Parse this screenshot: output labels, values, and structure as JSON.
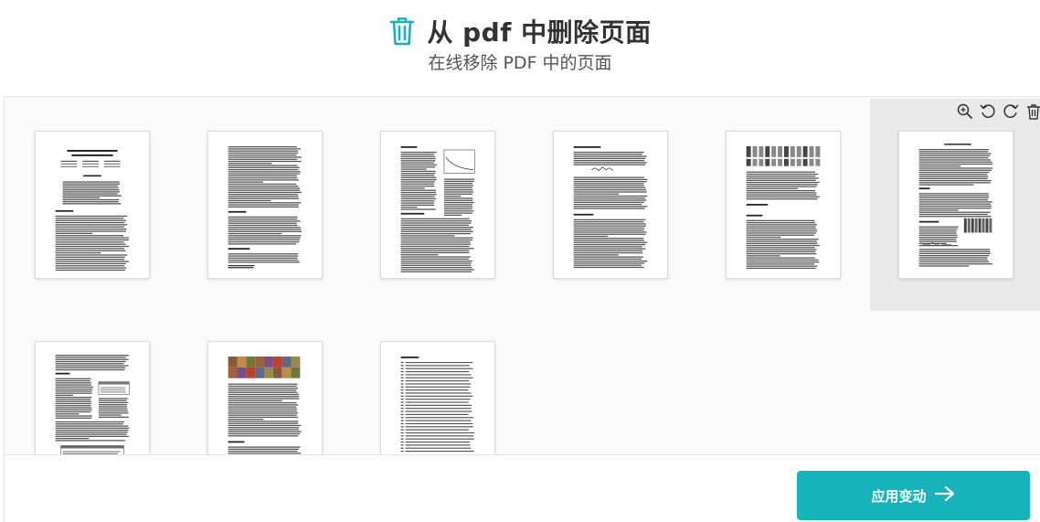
{
  "header": {
    "title": "从 pdf 中删除页面",
    "subtitle": "在线移除 PDF 中的页面",
    "icon": "trash-icon"
  },
  "colors": {
    "accent": "#17b3ba",
    "title_text": "#333333",
    "selected_bg": "#e9e9e9"
  },
  "pages": [
    {
      "id": 1,
      "style": "title",
      "selected": false
    },
    {
      "id": 2,
      "style": "text",
      "selected": false
    },
    {
      "id": 3,
      "style": "text-figure-right",
      "selected": false
    },
    {
      "id": 4,
      "style": "text-equation",
      "selected": false
    },
    {
      "id": 5,
      "style": "figure-top",
      "selected": false
    },
    {
      "id": 6,
      "style": "text-figure-mid",
      "selected": true
    },
    {
      "id": 7,
      "style": "text-tables",
      "selected": false
    },
    {
      "id": 8,
      "style": "image-strip",
      "selected": false
    },
    {
      "id": 9,
      "style": "references",
      "selected": false
    }
  ],
  "page_tools": {
    "zoom": "zoom-in-icon",
    "rotate_left": "rotate-left-icon",
    "rotate_right": "rotate-right-icon",
    "delete": "trash-icon"
  },
  "footer": {
    "apply_label": "应用变动",
    "apply_icon": "arrow-right-icon"
  }
}
